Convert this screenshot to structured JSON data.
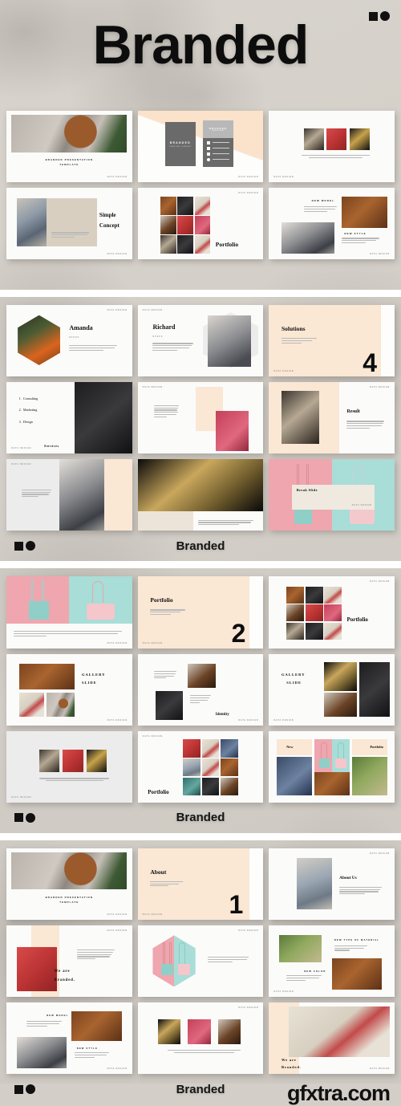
{
  "header": {
    "title": "Branded",
    "logo_icon": "square-circle-logo"
  },
  "watermark": {
    "text": "gfxtra.com"
  },
  "footers": [
    {
      "brand": "Branded",
      "logo_icon": "square-circle-logo"
    },
    {
      "brand": "Branded",
      "logo_icon": "square-circle-logo"
    },
    {
      "brand": "Branded",
      "logo_icon": "square-circle-logo"
    }
  ],
  "common": {
    "tag": "DATA DESIGN"
  },
  "sections": [
    {
      "id": "section-1",
      "slides": [
        {
          "id": "cover",
          "title": "BRANDED PRESENTATION",
          "subtitle": "TEMPLATE",
          "tag": "DATA DESIGN"
        },
        {
          "id": "business-cards",
          "title": "BRANDED",
          "subtitle": "PREMIUM COMPANY",
          "tag": "DATA DESIGN"
        },
        {
          "id": "three-images",
          "tag": "DATA DESIGN"
        },
        {
          "id": "simple-concept",
          "title": "Simple",
          "title2": "Concept",
          "tag": "DATA DESIGN"
        },
        {
          "id": "portfolio-grid",
          "title": "Portfolio",
          "tag": "DATA DESIGN"
        },
        {
          "id": "new-model-style",
          "title": "NEW MODEL",
          "title2": "NEW STYLE",
          "tag": "DATA DESIGN"
        }
      ]
    },
    {
      "id": "section-2",
      "slides": [
        {
          "id": "amanda",
          "title": "Amanda",
          "subtitle": "STAFF",
          "tag": "DATA DESIGN"
        },
        {
          "id": "richard",
          "title": "Richard",
          "subtitle": "STAFF",
          "tag": "DATA DESIGN"
        },
        {
          "id": "solutions",
          "title": "Solutions",
          "number": "4",
          "tag": "DATA DESIGN"
        },
        {
          "id": "services",
          "label": "Services",
          "list": [
            "Consulting",
            "Marketing",
            "Design"
          ],
          "tag": "DATA DESIGN"
        },
        {
          "id": "text-image",
          "tag": "DATA DESIGN"
        },
        {
          "id": "result",
          "title": "Result",
          "tag": "DATA DESIGN"
        },
        {
          "id": "stairs-model",
          "tag": "DATA DESIGN"
        },
        {
          "id": "basket-bag",
          "tag": "DATA DESIGN"
        },
        {
          "id": "break-slide",
          "title": "Break Slide",
          "tag": "DATA DESIGN"
        }
      ]
    },
    {
      "id": "section-3",
      "slides": [
        {
          "id": "pastel-bags",
          "tag": "DATA DESIGN"
        },
        {
          "id": "portfolio-number",
          "title": "Portfolio",
          "number": "2",
          "tag": "DATA DESIGN"
        },
        {
          "id": "portfolio-mosaic",
          "title": "Portfolio",
          "tag": "DATA DESIGN"
        },
        {
          "id": "gallery-slide-1",
          "title": "GALLERY",
          "title2": "SLIDE",
          "tag": "DATA DESIGN"
        },
        {
          "id": "identity",
          "title": "Identity",
          "tag": "DATA DESIGN"
        },
        {
          "id": "gallery-slide-2",
          "title": "GALLERY",
          "title2": "SLIDE",
          "tag": "DATA DESIGN"
        },
        {
          "id": "three-thumbs",
          "tag": "DATA DESIGN"
        },
        {
          "id": "portfolio-mosaic-2",
          "title": "Portfolio",
          "tag": "DATA DESIGN"
        },
        {
          "id": "new-portfolio",
          "title": "New",
          "title2": "Portfolio",
          "tag": "DATA DESIGN"
        }
      ]
    },
    {
      "id": "section-4",
      "slides": [
        {
          "id": "cover-2",
          "title": "BRANDED PRESENTATION",
          "subtitle": "TEMPLATE",
          "tag": "DATA DESIGN"
        },
        {
          "id": "about-number",
          "title": "About",
          "number": "1",
          "tag": "DATA DESIGN"
        },
        {
          "id": "about-us",
          "title": "About Us",
          "tag": "DATA DESIGN"
        },
        {
          "id": "we-are-branded-1",
          "title": "We are",
          "title2": "Branded.",
          "tag": "DATA DESIGN"
        },
        {
          "id": "hexagon-bags",
          "tag": "DATA DESIGN"
        },
        {
          "id": "material-color",
          "title": "NEW TYPE OF MATERIAL",
          "title2": "NEW COLOR",
          "tag": "DATA DESIGN"
        },
        {
          "id": "model-style",
          "title": "NEW MODEL",
          "title2": "NEW STYLE",
          "tag": "DATA DESIGN"
        },
        {
          "id": "three-thumbs-2",
          "tag": "DATA DESIGN"
        },
        {
          "id": "we-are-branded-2",
          "title": "We are",
          "title2": "Branded.",
          "tag": "DATA DESIGN"
        }
      ]
    }
  ]
}
